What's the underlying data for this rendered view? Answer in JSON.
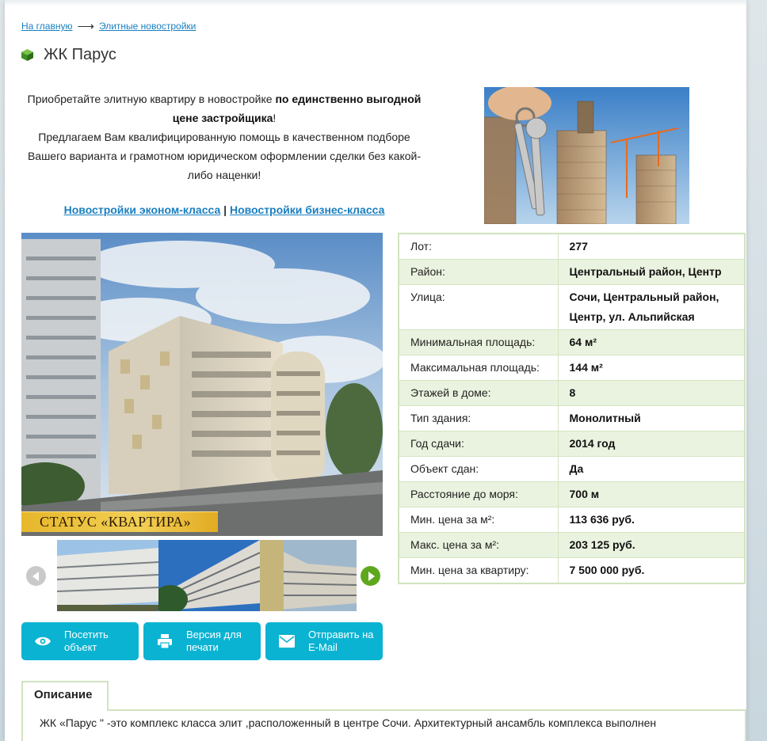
{
  "breadcrumb": {
    "home": "На главную",
    "separator": "⟶",
    "section": "Элитные новостройки"
  },
  "page_title": "ЖК Парус",
  "intro": {
    "text1": "Приобретайте элитную квартиру в новостройке ",
    "bold1": "по единственно выгодной цене застройщика",
    "text2": "!",
    "text3": "Предлагаем Вам квалифицированную помощь в качественном подборе Вашего варианта и грамотном юридическом оформлении сделки без какой-либо наценки",
    "text4": "!"
  },
  "links": {
    "economy": "Новостройки эконом-класса",
    "separator": "|",
    "business": "Новостройки бизнес-класса"
  },
  "photo_banner": "СТАТУС «КВАРТИРА»",
  "specs": [
    {
      "key": "Лот:",
      "value": "277"
    },
    {
      "key": "Район:",
      "value": "Центральный район, Центр"
    },
    {
      "key": "Улица:",
      "value": "Сочи, Центральный район, Центр, ул. Альпийская"
    },
    {
      "key": "Минимальная площадь:",
      "value": "64 м²"
    },
    {
      "key": "Максимальная площадь:",
      "value": "144 м²"
    },
    {
      "key": "Этажей в доме:",
      "value": "8"
    },
    {
      "key": "Тип здания:",
      "value": "Монолитный"
    },
    {
      "key": "Год сдачи:",
      "value": "2014 год"
    },
    {
      "key": "Объект сдан:",
      "value": "Да"
    },
    {
      "key": "Расстояние до моря:",
      "value": "700 м"
    },
    {
      "key": "Мин. цена за м²:",
      "value": "113 636 руб."
    },
    {
      "key": "Макс. цена за м²:",
      "value": "203 125 руб."
    },
    {
      "key": "Мин. цена за квартиру:",
      "value": "7 500 000 руб."
    }
  ],
  "actions": {
    "visit": "Посетить объект",
    "print": "Версия для печати",
    "email": "Отправить на E-Mail"
  },
  "description": {
    "tab": "Описание",
    "text": "ЖК «Парус \" -это комплекс класса элит ,расположенный в центре Сочи. Архитектурный ансамбль комплекса выполнен"
  },
  "colors": {
    "link": "#1a7fc0",
    "action": "#0ab3d2",
    "table_border": "#d1e4bf",
    "table_stripe": "#eaf3df",
    "next_button": "#5fa81e",
    "banner": "#f2cf55"
  },
  "icons": [
    "cube-icon",
    "eye-icon",
    "printer-icon",
    "envelope-icon",
    "arrow-left-icon",
    "arrow-right-icon"
  ]
}
